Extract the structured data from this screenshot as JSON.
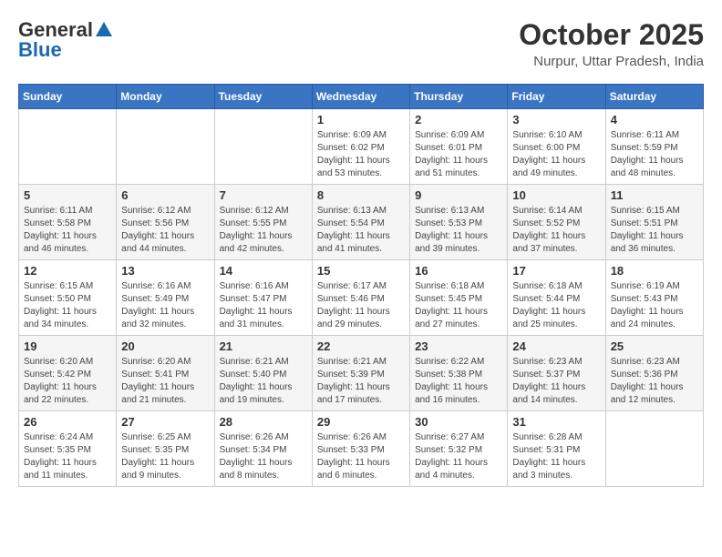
{
  "header": {
    "logo_general": "General",
    "logo_blue": "Blue",
    "month_title": "October 2025",
    "location": "Nurpur, Uttar Pradesh, India"
  },
  "days_of_week": [
    "Sunday",
    "Monday",
    "Tuesday",
    "Wednesday",
    "Thursday",
    "Friday",
    "Saturday"
  ],
  "weeks": [
    [
      {
        "day": "",
        "info": ""
      },
      {
        "day": "",
        "info": ""
      },
      {
        "day": "",
        "info": ""
      },
      {
        "day": "1",
        "info": "Sunrise: 6:09 AM\nSunset: 6:02 PM\nDaylight: 11 hours\nand 53 minutes."
      },
      {
        "day": "2",
        "info": "Sunrise: 6:09 AM\nSunset: 6:01 PM\nDaylight: 11 hours\nand 51 minutes."
      },
      {
        "day": "3",
        "info": "Sunrise: 6:10 AM\nSunset: 6:00 PM\nDaylight: 11 hours\nand 49 minutes."
      },
      {
        "day": "4",
        "info": "Sunrise: 6:11 AM\nSunset: 5:59 PM\nDaylight: 11 hours\nand 48 minutes."
      }
    ],
    [
      {
        "day": "5",
        "info": "Sunrise: 6:11 AM\nSunset: 5:58 PM\nDaylight: 11 hours\nand 46 minutes."
      },
      {
        "day": "6",
        "info": "Sunrise: 6:12 AM\nSunset: 5:56 PM\nDaylight: 11 hours\nand 44 minutes."
      },
      {
        "day": "7",
        "info": "Sunrise: 6:12 AM\nSunset: 5:55 PM\nDaylight: 11 hours\nand 42 minutes."
      },
      {
        "day": "8",
        "info": "Sunrise: 6:13 AM\nSunset: 5:54 PM\nDaylight: 11 hours\nand 41 minutes."
      },
      {
        "day": "9",
        "info": "Sunrise: 6:13 AM\nSunset: 5:53 PM\nDaylight: 11 hours\nand 39 minutes."
      },
      {
        "day": "10",
        "info": "Sunrise: 6:14 AM\nSunset: 5:52 PM\nDaylight: 11 hours\nand 37 minutes."
      },
      {
        "day": "11",
        "info": "Sunrise: 6:15 AM\nSunset: 5:51 PM\nDaylight: 11 hours\nand 36 minutes."
      }
    ],
    [
      {
        "day": "12",
        "info": "Sunrise: 6:15 AM\nSunset: 5:50 PM\nDaylight: 11 hours\nand 34 minutes."
      },
      {
        "day": "13",
        "info": "Sunrise: 6:16 AM\nSunset: 5:49 PM\nDaylight: 11 hours\nand 32 minutes."
      },
      {
        "day": "14",
        "info": "Sunrise: 6:16 AM\nSunset: 5:47 PM\nDaylight: 11 hours\nand 31 minutes."
      },
      {
        "day": "15",
        "info": "Sunrise: 6:17 AM\nSunset: 5:46 PM\nDaylight: 11 hours\nand 29 minutes."
      },
      {
        "day": "16",
        "info": "Sunrise: 6:18 AM\nSunset: 5:45 PM\nDaylight: 11 hours\nand 27 minutes."
      },
      {
        "day": "17",
        "info": "Sunrise: 6:18 AM\nSunset: 5:44 PM\nDaylight: 11 hours\nand 25 minutes."
      },
      {
        "day": "18",
        "info": "Sunrise: 6:19 AM\nSunset: 5:43 PM\nDaylight: 11 hours\nand 24 minutes."
      }
    ],
    [
      {
        "day": "19",
        "info": "Sunrise: 6:20 AM\nSunset: 5:42 PM\nDaylight: 11 hours\nand 22 minutes."
      },
      {
        "day": "20",
        "info": "Sunrise: 6:20 AM\nSunset: 5:41 PM\nDaylight: 11 hours\nand 21 minutes."
      },
      {
        "day": "21",
        "info": "Sunrise: 6:21 AM\nSunset: 5:40 PM\nDaylight: 11 hours\nand 19 minutes."
      },
      {
        "day": "22",
        "info": "Sunrise: 6:21 AM\nSunset: 5:39 PM\nDaylight: 11 hours\nand 17 minutes."
      },
      {
        "day": "23",
        "info": "Sunrise: 6:22 AM\nSunset: 5:38 PM\nDaylight: 11 hours\nand 16 minutes."
      },
      {
        "day": "24",
        "info": "Sunrise: 6:23 AM\nSunset: 5:37 PM\nDaylight: 11 hours\nand 14 minutes."
      },
      {
        "day": "25",
        "info": "Sunrise: 6:23 AM\nSunset: 5:36 PM\nDaylight: 11 hours\nand 12 minutes."
      }
    ],
    [
      {
        "day": "26",
        "info": "Sunrise: 6:24 AM\nSunset: 5:35 PM\nDaylight: 11 hours\nand 11 minutes."
      },
      {
        "day": "27",
        "info": "Sunrise: 6:25 AM\nSunset: 5:35 PM\nDaylight: 11 hours\nand 9 minutes."
      },
      {
        "day": "28",
        "info": "Sunrise: 6:26 AM\nSunset: 5:34 PM\nDaylight: 11 hours\nand 8 minutes."
      },
      {
        "day": "29",
        "info": "Sunrise: 6:26 AM\nSunset: 5:33 PM\nDaylight: 11 hours\nand 6 minutes."
      },
      {
        "day": "30",
        "info": "Sunrise: 6:27 AM\nSunset: 5:32 PM\nDaylight: 11 hours\nand 4 minutes."
      },
      {
        "day": "31",
        "info": "Sunrise: 6:28 AM\nSunset: 5:31 PM\nDaylight: 11 hours\nand 3 minutes."
      },
      {
        "day": "",
        "info": ""
      }
    ]
  ]
}
